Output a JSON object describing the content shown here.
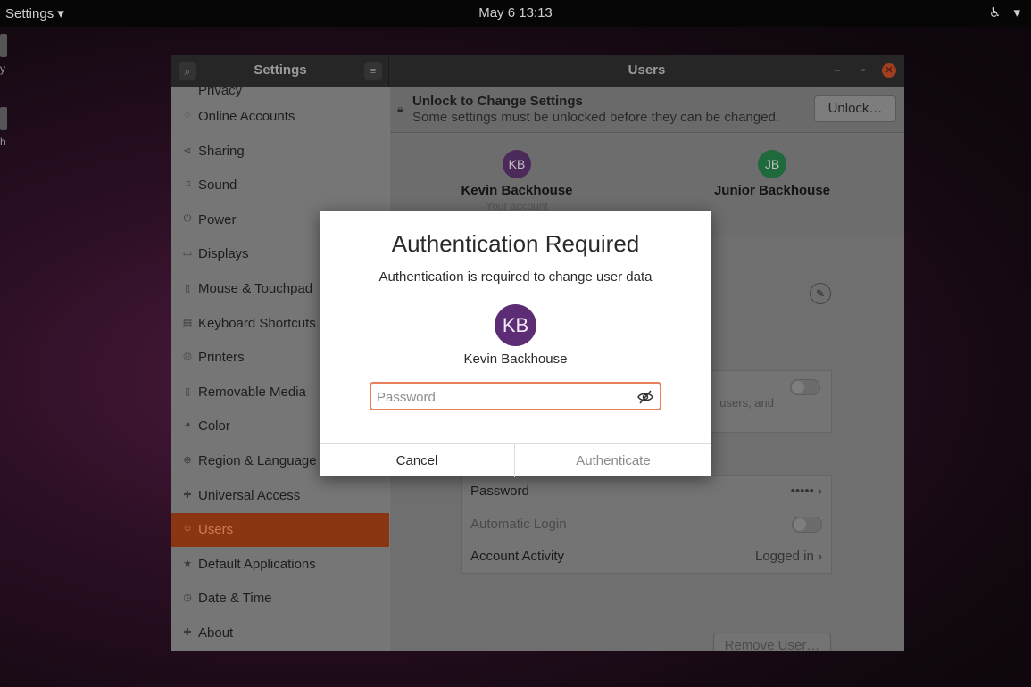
{
  "topbar": {
    "app_menu": "Settings ▾",
    "clock": "May 6  13:13",
    "accessibility_icon": "accessibility-icon",
    "system_menu_icon": "chevron-down-icon",
    "edge_text_1": "y",
    "edge_text_2": "h"
  },
  "window": {
    "sidebar_title": "Settings",
    "panel_title": "Users",
    "sidebar": {
      "partial_item": "Privacy",
      "items": [
        {
          "label": "Online Accounts",
          "icon": "◌"
        },
        {
          "label": "Sharing",
          "icon": "⋖"
        },
        {
          "label": "Sound",
          "icon": "♫"
        },
        {
          "label": "Power",
          "icon": "⏻"
        },
        {
          "label": "Displays",
          "icon": "▭"
        },
        {
          "label": "Mouse & Touchpad",
          "icon": "▯"
        },
        {
          "label": "Keyboard Shortcuts",
          "icon": "▤"
        },
        {
          "label": "Printers",
          "icon": "⎙"
        },
        {
          "label": "Removable Media",
          "icon": "▯"
        },
        {
          "label": "Color",
          "icon": "◕"
        },
        {
          "label": "Region & Language",
          "icon": "⊕"
        },
        {
          "label": "Universal Access",
          "icon": "✚"
        },
        {
          "label": "Users",
          "icon": "☺",
          "active": true
        },
        {
          "label": "Default Applications",
          "icon": "★"
        },
        {
          "label": "Date & Time",
          "icon": "◷"
        },
        {
          "label": "About",
          "icon": "✚"
        }
      ]
    },
    "unlock_bar": {
      "title": "Unlock to Change Settings",
      "subtitle": "Some settings must be unlocked before they can be changed.",
      "button": "Unlock…"
    },
    "users": [
      {
        "initials": "KB",
        "name": "Kevin Backhouse",
        "subtitle": "Your account",
        "color": "#4b2a5a"
      },
      {
        "initials": "JB",
        "name": "Junior Backhouse",
        "subtitle": "",
        "color": "#1f6a3c"
      }
    ],
    "partial_text": "users, and",
    "account_rows": [
      {
        "label": "Password",
        "value": "••••• ›"
      },
      {
        "label": "Automatic Login",
        "value": ""
      },
      {
        "label": "Account Activity",
        "value": "Logged in ›"
      }
    ],
    "remove_button": "Remove User…"
  },
  "dialog": {
    "title": "Authentication Required",
    "message": "Authentication is required to change user data",
    "avatar_initials": "KB",
    "user_name": "Kevin Backhouse",
    "password_placeholder": "Password",
    "password_value": "",
    "cancel_label": "Cancel",
    "authenticate_label": "Authenticate",
    "accent_color": "#e9805b"
  }
}
